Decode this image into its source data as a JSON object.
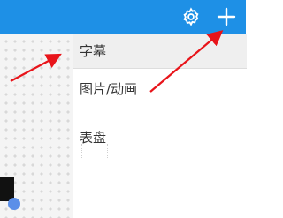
{
  "toolbar": {
    "settings_icon": "gear-icon",
    "add_icon": "plus-icon",
    "background_color": "#1e90e6"
  },
  "menu": {
    "items": [
      {
        "label": "字幕"
      },
      {
        "label": "图片/动画"
      },
      {
        "label": "表盘"
      }
    ]
  },
  "annotations": {
    "arrow_color": "#e8141a"
  }
}
